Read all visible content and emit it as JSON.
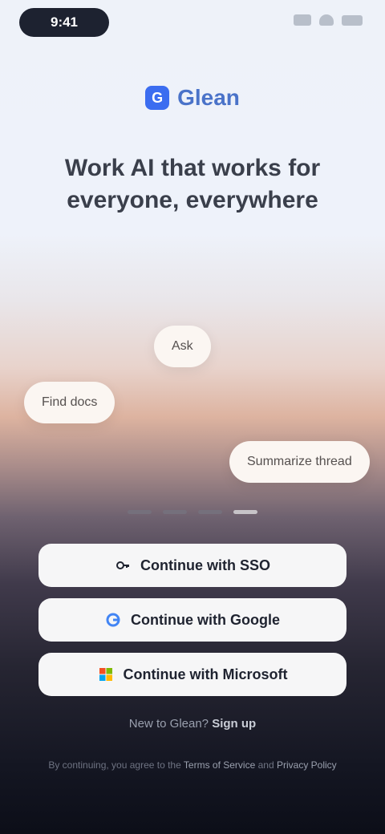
{
  "status_bar": {
    "time": "9:41"
  },
  "brand": {
    "logo_letter": "G",
    "name": "Glean"
  },
  "headline": "Work AI that works for everyone, everywhere",
  "chips": [
    {
      "label": "Ask"
    },
    {
      "label": "Find docs"
    },
    {
      "label": "Summarize thread"
    }
  ],
  "carousel": {
    "active_index": 3,
    "count": 4
  },
  "buttons": [
    {
      "label": "Continue with SSO",
      "icon": "key-icon"
    },
    {
      "label": "Continue with Google",
      "icon": "google-icon"
    },
    {
      "label": "Continue with Microsoft",
      "icon": "microsoft-icon"
    }
  ],
  "signup": {
    "prompt": "New to Glean?",
    "link": "Sign up"
  },
  "legal": {
    "text": "By continuing, you agree to the",
    "terms": "Terms of Service",
    "and": "and",
    "privacy": "Privacy Policy"
  }
}
